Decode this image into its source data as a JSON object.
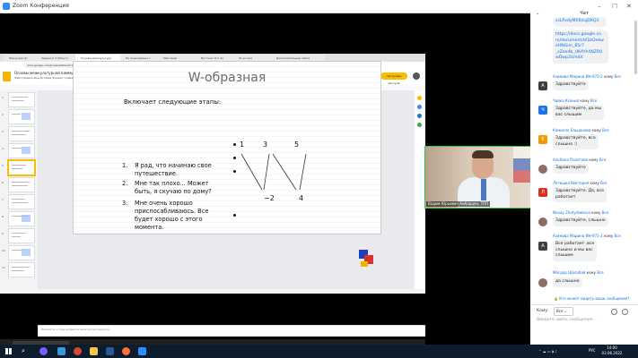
{
  "window": {
    "title": "Zoom Конференция",
    "controls": [
      "–",
      "□",
      "✕"
    ]
  },
  "browser": {
    "tabs": [
      "Фокусная (2)",
      "Задачи и 3 (Мое С)",
      "Основы межкультурн",
      "Не подходящие с",
      "Мои прав",
      "Ве Точно Я С Ан",
      "Зк ки пре",
      "Дополнительные образ"
    ],
    "url": "docs.google.com/presentation/d/1xOsnovy-mezhkulturnoy-kommunikatsii/edit#slide=id.p5"
  },
  "slides_app": {
    "doc_title": "Основы межкультурной коммуникации (ФГ2)",
    "menu": "Файл  Правка  Вид  Вставка  Формат  Слайд  Объект  Инструменты  Дополнения  Справка  Последние изменения: 30 минут назад",
    "present_label": "Слайд-шоу",
    "share_label": "Настройки доступа",
    "notes_placeholder": "Нажмите, чтобы добавить заметки докладчика"
  },
  "slide": {
    "title": "W-образная",
    "intro": "Включает следующие этапы:",
    "items": [
      {
        "num": "1.",
        "text_lines": [
          "Я рад, что начинаю свое",
          "путешествие."
        ]
      },
      {
        "num": "2.",
        "text_lines": [
          "Мне так плохо... Может",
          "быть, я скучаю по дому?"
        ]
      },
      {
        "num": "3.",
        "text_lines": [
          "Мне очень хорошо",
          "приспосабливаюсь. Все",
          "будет хорошо с этого",
          "момента."
        ]
      }
    ],
    "w_labels": {
      "p1": "1",
      "p3": "3",
      "p5": "5",
      "p2": "2",
      "p4": "4"
    }
  },
  "video": {
    "participant_name": "Вадим Юрьевич Амбарцян, ТПП"
  },
  "chat": {
    "title": "Чат",
    "messages": [
      {
        "avatar_letter": "",
        "avatar_color": "#ffffff",
        "header": "",
        "sender": "",
        "to": "",
        "lines": [
          "ssLPxdyMX6lcqDRQ1"
        ]
      },
      {
        "avatar_letter": "",
        "avatar_color": "#ffffff",
        "header": "",
        "sender": "",
        "to": "",
        "lines": [
          "https://docs.google.co",
          "m/document/d/1bOekw",
          "eHNGim_85r7",
          "_sZeo4b_UKAYh4NZR0",
          "wDwp2U/edit"
        ]
      },
      {
        "avatar_letter": "А",
        "avatar_color": "#3c4043",
        "sender": "Азимова Мадина ИН-971-2",
        "to": "Все",
        "lines": [
          "Здравствуйте"
        ]
      },
      {
        "avatar_letter": "Ч",
        "avatar_color": "#1a73e8",
        "sender": "Чайка Ксения",
        "to": "Все",
        "lines": [
          "Здравствуйте, да мы",
          "вас слышим"
        ]
      },
      {
        "avatar_letter": "Е",
        "avatar_color": "#f29900",
        "sender": "Камилла Ельцанова",
        "to": "Все",
        "lines": [
          "Здравствуйте, все",
          "слышно :)"
        ]
      },
      {
        "avatar_letter": "",
        "avatar_color": "#8d6e63",
        "sender": "Альбина Полатова",
        "to": "Все",
        "lines": [
          "Здравствуйте"
        ]
      },
      {
        "avatar_letter": "Л",
        "avatar_color": "#d93025",
        "sender": "Летишко Виктория",
        "to": "Все",
        "lines": [
          "Здравствуйте. Да, все",
          "работает"
        ]
      },
      {
        "avatar_letter": "",
        "avatar_color": "#8d6e63",
        "sender": "Nonay Zhetyrbekova",
        "to": "Все",
        "lines": [
          "Здравствуйте, слышно"
        ]
      },
      {
        "avatar_letter": "А",
        "avatar_color": "#3c4043",
        "sender": "Азимова Мадина ИН-971-2",
        "to": "Все",
        "lines": [
          "Все работает ,все",
          "слышно и мы вас",
          "слышим"
        ]
      },
      {
        "avatar_letter": "",
        "avatar_color": "#8d6e63",
        "sender": "Мёсдар Шалабай",
        "to": "Все",
        "lines": [
          "да слышно"
        ]
      }
    ],
    "who_can_see": "Кто может видеть ваши сообщения?",
    "to_label": "Кому:",
    "to_value": "Все",
    "input_placeholder": "Введите здесь сообщение..."
  },
  "taskbar": {
    "time": "14:00",
    "date": "03.06.2022",
    "lang": "РУС"
  }
}
